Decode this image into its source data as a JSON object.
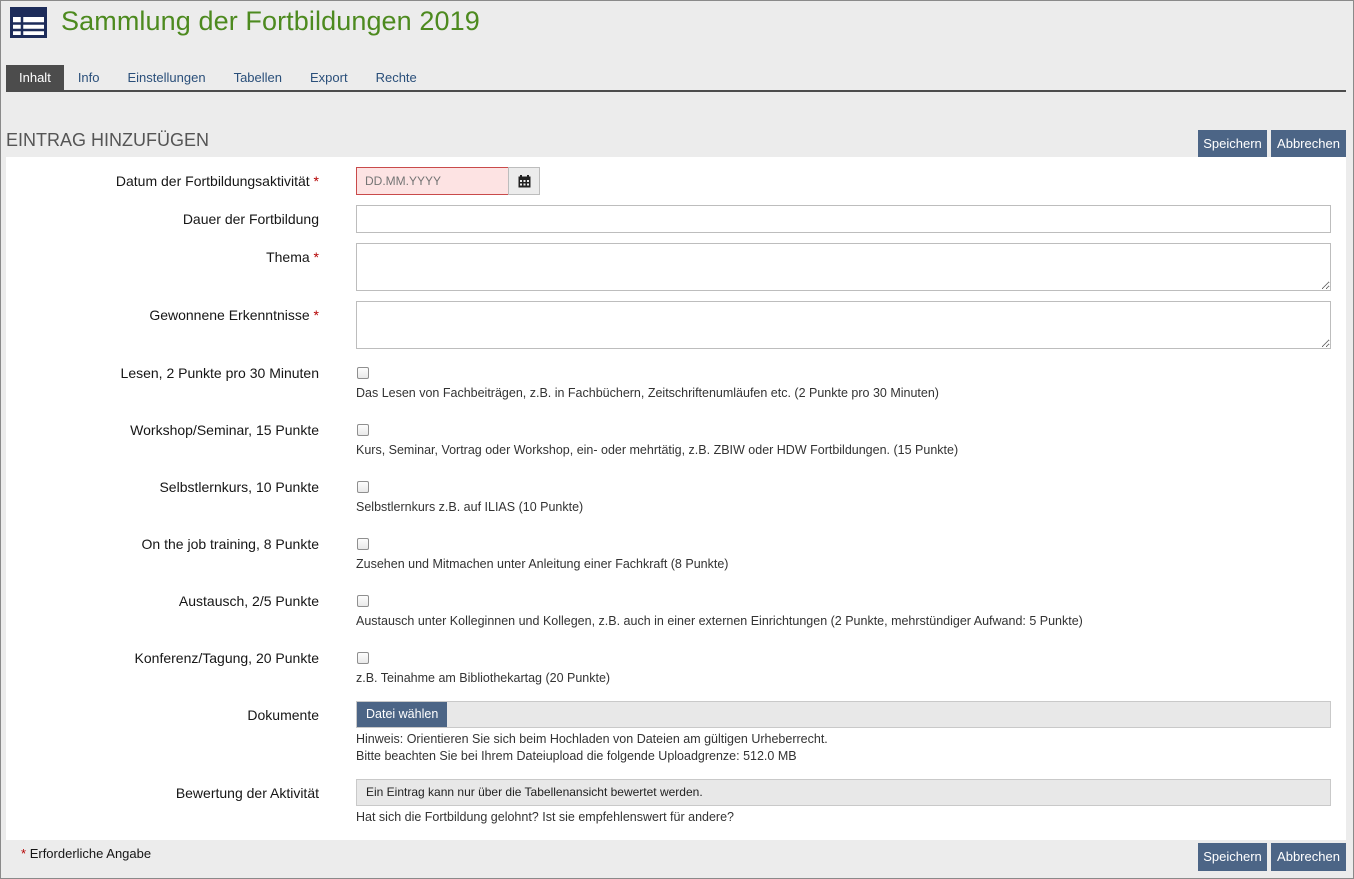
{
  "colors": {
    "accent_green": "#4d8a1f",
    "button_blue": "#4c6586",
    "required_red": "#b40000"
  },
  "header": {
    "icon": "table-icon",
    "title": "Sammlung der Fortbildungen 2019"
  },
  "tabs": [
    {
      "label": "Inhalt",
      "active": true
    },
    {
      "label": "Info"
    },
    {
      "label": "Einstellungen"
    },
    {
      "label": "Tabellen"
    },
    {
      "label": "Export"
    },
    {
      "label": "Rechte"
    }
  ],
  "section": {
    "title": "EINTRAG HINZUFÜGEN"
  },
  "buttons": {
    "save": "Speichern",
    "cancel": "Abbrechen"
  },
  "form": {
    "required_mark": "*",
    "date": {
      "label": "Datum der Fortbildungsaktivität",
      "placeholder": "DD.MM.YYYY",
      "icon": "calendar-icon"
    },
    "duration": {
      "label": "Dauer der Fortbildung",
      "value": ""
    },
    "topic": {
      "label": "Thema",
      "value": ""
    },
    "insights": {
      "label": "Gewonnene Erkenntnisse",
      "value": ""
    },
    "checkboxes": [
      {
        "label": "Lesen, 2 Punkte pro 30 Minuten",
        "help": "Das Lesen von Fachbeiträgen, z.B. in Fachbüchern, Zeitschriftenumläufen etc. (2 Punkte pro 30 Minuten)",
        "checked": false
      },
      {
        "label": "Workshop/Seminar, 15 Punkte",
        "help": "Kurs, Seminar, Vortrag oder Workshop, ein- oder mehrtätig, z.B. ZBIW oder HDW Fortbildungen. (15 Punkte)",
        "checked": false
      },
      {
        "label": "Selbstlernkurs, 10 Punkte",
        "help": "Selbstlernkurs z.B. auf ILIAS (10 Punkte)",
        "checked": false
      },
      {
        "label": "On the job training, 8 Punkte",
        "help": "Zusehen und Mitmachen unter Anleitung einer Fachkraft (8 Punkte)",
        "checked": false
      },
      {
        "label": "Austausch, 2/5 Punkte",
        "help": "Austausch unter Kolleginnen und Kollegen, z.B. auch in einer externen Einrichtungen (2 Punkte, mehrstündiger Aufwand: 5 Punkte)",
        "checked": false
      },
      {
        "label": "Konferenz/Tagung, 20 Punkte",
        "help": "z.B. Teinahme am Bibliothekartag (20 Punkte)",
        "checked": false
      }
    ],
    "documents": {
      "label": "Dokumente",
      "button": "Datei wählen",
      "hint1": "Hinweis: Orientieren Sie sich beim Hochladen von Dateien am gültigen Urheberrecht.",
      "hint2": "Bitte beachten Sie bei Ihrem Dateiupload die folgende Uploadgrenze: 512.0 MB"
    },
    "rating": {
      "label": "Bewertung der Aktivität",
      "value": "Ein Eintrag kann nur über die Tabellenansicht bewertet werden.",
      "help": "Hat sich die Fortbildung gelohnt? Ist sie empfehlenswert für andere?"
    }
  },
  "footer": {
    "required_note": "Erforderliche Angabe"
  }
}
